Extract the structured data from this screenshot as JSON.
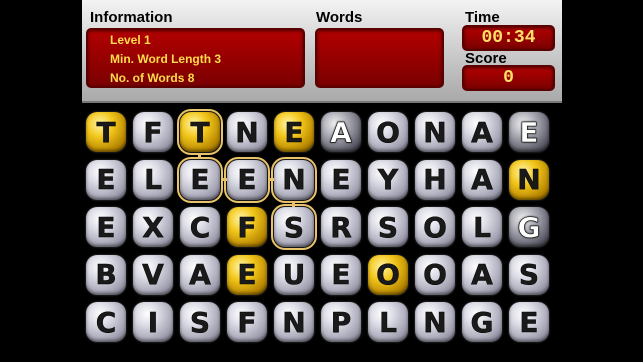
{
  "header": {
    "info_title": "Information",
    "words_title": "Words",
    "time_title": "Time",
    "score_title": "Score",
    "info_lines": [
      "Level 1",
      "Min. Word Length 3",
      "No. of Words 8"
    ],
    "time_value": "00:34",
    "score_value": "0"
  },
  "colors": {
    "box": "#9a0000",
    "gold_text": "#ffdc4a",
    "selection": "#e9c36a"
  },
  "grid": [
    [
      {
        "l": "T",
        "s": "gold"
      },
      {
        "l": "F",
        "s": "gray"
      },
      {
        "l": "T",
        "s": "gold",
        "sel": true
      },
      {
        "l": "N",
        "s": "gray"
      },
      {
        "l": "E",
        "s": "gold"
      },
      {
        "l": "A",
        "s": "dark"
      },
      {
        "l": "O",
        "s": "gray"
      },
      {
        "l": "N",
        "s": "gray"
      },
      {
        "l": "A",
        "s": "gray"
      },
      {
        "l": "E",
        "s": "dark"
      }
    ],
    [
      {
        "l": "E",
        "s": "gray"
      },
      {
        "l": "L",
        "s": "gray"
      },
      {
        "l": "E",
        "s": "gray",
        "sel": true
      },
      {
        "l": "E",
        "s": "gray",
        "sel": true
      },
      {
        "l": "N",
        "s": "gray",
        "sel": true
      },
      {
        "l": "E",
        "s": "gray"
      },
      {
        "l": "Y",
        "s": "gray"
      },
      {
        "l": "H",
        "s": "gray"
      },
      {
        "l": "A",
        "s": "gray"
      },
      {
        "l": "N",
        "s": "gold"
      }
    ],
    [
      {
        "l": "E",
        "s": "gray"
      },
      {
        "l": "X",
        "s": "gray"
      },
      {
        "l": "C",
        "s": "gray"
      },
      {
        "l": "F",
        "s": "gold"
      },
      {
        "l": "S",
        "s": "gray",
        "sel": true
      },
      {
        "l": "R",
        "s": "gray"
      },
      {
        "l": "S",
        "s": "gray"
      },
      {
        "l": "O",
        "s": "gray"
      },
      {
        "l": "L",
        "s": "gray"
      },
      {
        "l": "G",
        "s": "dark"
      }
    ],
    [
      {
        "l": "B",
        "s": "gray"
      },
      {
        "l": "V",
        "s": "gray"
      },
      {
        "l": "A",
        "s": "gray"
      },
      {
        "l": "E",
        "s": "gold"
      },
      {
        "l": "U",
        "s": "gray"
      },
      {
        "l": "E",
        "s": "gray"
      },
      {
        "l": "O",
        "s": "gold"
      },
      {
        "l": "O",
        "s": "gray"
      },
      {
        "l": "A",
        "s": "gray"
      },
      {
        "l": "S",
        "s": "gray"
      }
    ],
    [
      {
        "l": "C",
        "s": "gray"
      },
      {
        "l": "I",
        "s": "gray"
      },
      {
        "l": "S",
        "s": "gray"
      },
      {
        "l": "F",
        "s": "gray"
      },
      {
        "l": "N",
        "s": "gray"
      },
      {
        "l": "P",
        "s": "gray"
      },
      {
        "l": "L",
        "s": "gray"
      },
      {
        "l": "N",
        "s": "gray"
      },
      {
        "l": "G",
        "s": "gray"
      },
      {
        "l": "E",
        "s": "gray"
      }
    ]
  ]
}
